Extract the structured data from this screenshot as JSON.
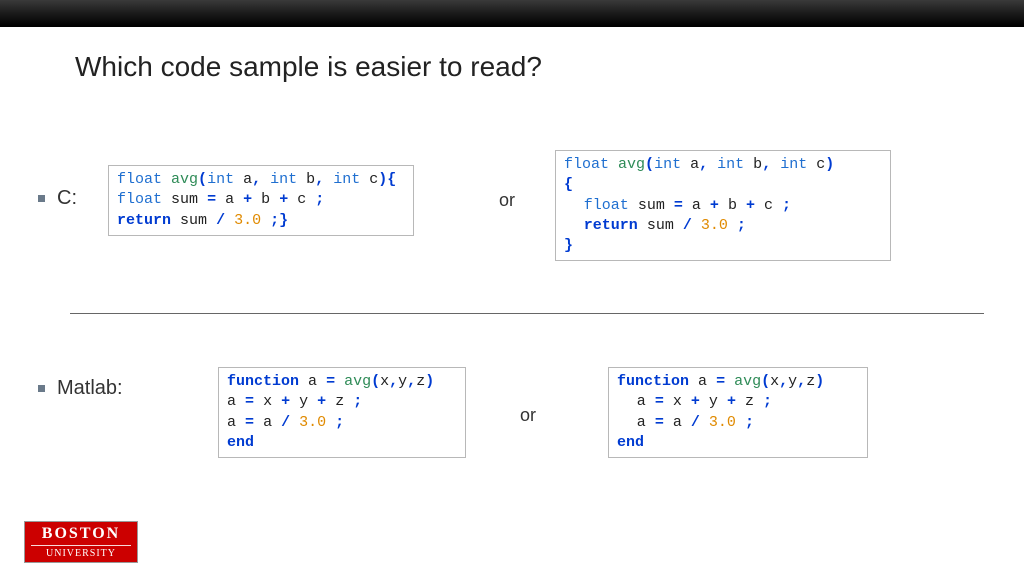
{
  "title": "Which code sample is easier to read?",
  "labels": {
    "c": "C:",
    "matlab": "Matlab:",
    "or": "or"
  },
  "code": {
    "c_left": {
      "l1": {
        "t1": "float",
        "fn": "avg",
        "p1": "(",
        "t2": "int",
        "a1": "a",
        "c1": ",",
        "t3": "int",
        "a2": "b",
        "c2": ",",
        "t4": "int",
        "a3": "c",
        "p2": "){",
        "sp": " "
      },
      "l2": {
        "t1": "float",
        "id": "sum",
        "eq": "=",
        "a": "a",
        "p1": "+",
        "b": "b",
        "p2": "+",
        "c": "c",
        "sc": ";",
        "sp": " "
      },
      "l3": {
        "kw": "return",
        "id": "sum",
        "sl": "/",
        "n": "3.0",
        "sc": ";",
        "rb": "}",
        "sp": " "
      }
    },
    "c_right": {
      "l1": {
        "t1": "float",
        "fn": "avg",
        "p1": "(",
        "t2": "int",
        "a1": "a",
        "c1": ",",
        "t3": "int",
        "a2": "b",
        "c2": ",",
        "t4": "int",
        "a3": "c",
        "p2": ")",
        "sp": " "
      },
      "l2": {
        "br": "{"
      },
      "l3": {
        "t1": "float",
        "id": "sum",
        "eq": "=",
        "a": "a",
        "p1": "+",
        "b": "b",
        "p2": "+",
        "c": "c",
        "sc": ";",
        "sp": " "
      },
      "l4": {
        "kw": "return",
        "id": "sum",
        "sl": "/",
        "n": "3.0",
        "sc": ";",
        "sp": " "
      },
      "l5": {
        "br": "}"
      }
    },
    "m_left": {
      "l1": {
        "kw": "function",
        "a": "a",
        "eq": "=",
        "fn": "avg",
        "po": "(",
        "x": "x",
        "c1": ",",
        "y": "y",
        "c2": ",",
        "z": "z",
        "pc": ")",
        "sp": " "
      },
      "l2": {
        "a": "a",
        "eq": "=",
        "x": "x",
        "p1": "+",
        "y": "y",
        "p2": "+",
        "z": "z",
        "sc": ";",
        "sp": " "
      },
      "l3": {
        "a": "a",
        "eq": "=",
        "a2": "a",
        "sl": "/",
        "n": "3.0",
        "sc": ";",
        "sp": " "
      },
      "l4": {
        "kw": "end"
      }
    },
    "m_right": {
      "l1": {
        "kw": "function",
        "a": "a",
        "eq": "=",
        "fn": "avg",
        "po": "(",
        "x": "x",
        "c1": ",",
        "y": "y",
        "c2": ",",
        "z": "z",
        "pc": ")",
        "sp": " "
      },
      "l2": {
        "a": "a",
        "eq": "=",
        "x": "x",
        "p1": "+",
        "y": "y",
        "p2": "+",
        "z": "z",
        "sc": ";",
        "sp": " "
      },
      "l3": {
        "a": "a",
        "eq": "=",
        "a2": "a",
        "sl": "/",
        "n": "3.0",
        "sc": ";",
        "sp": " "
      },
      "l4": {
        "kw": "end"
      }
    }
  },
  "logo": {
    "l1": "BOSTON",
    "l2": "UNIVERSITY"
  }
}
